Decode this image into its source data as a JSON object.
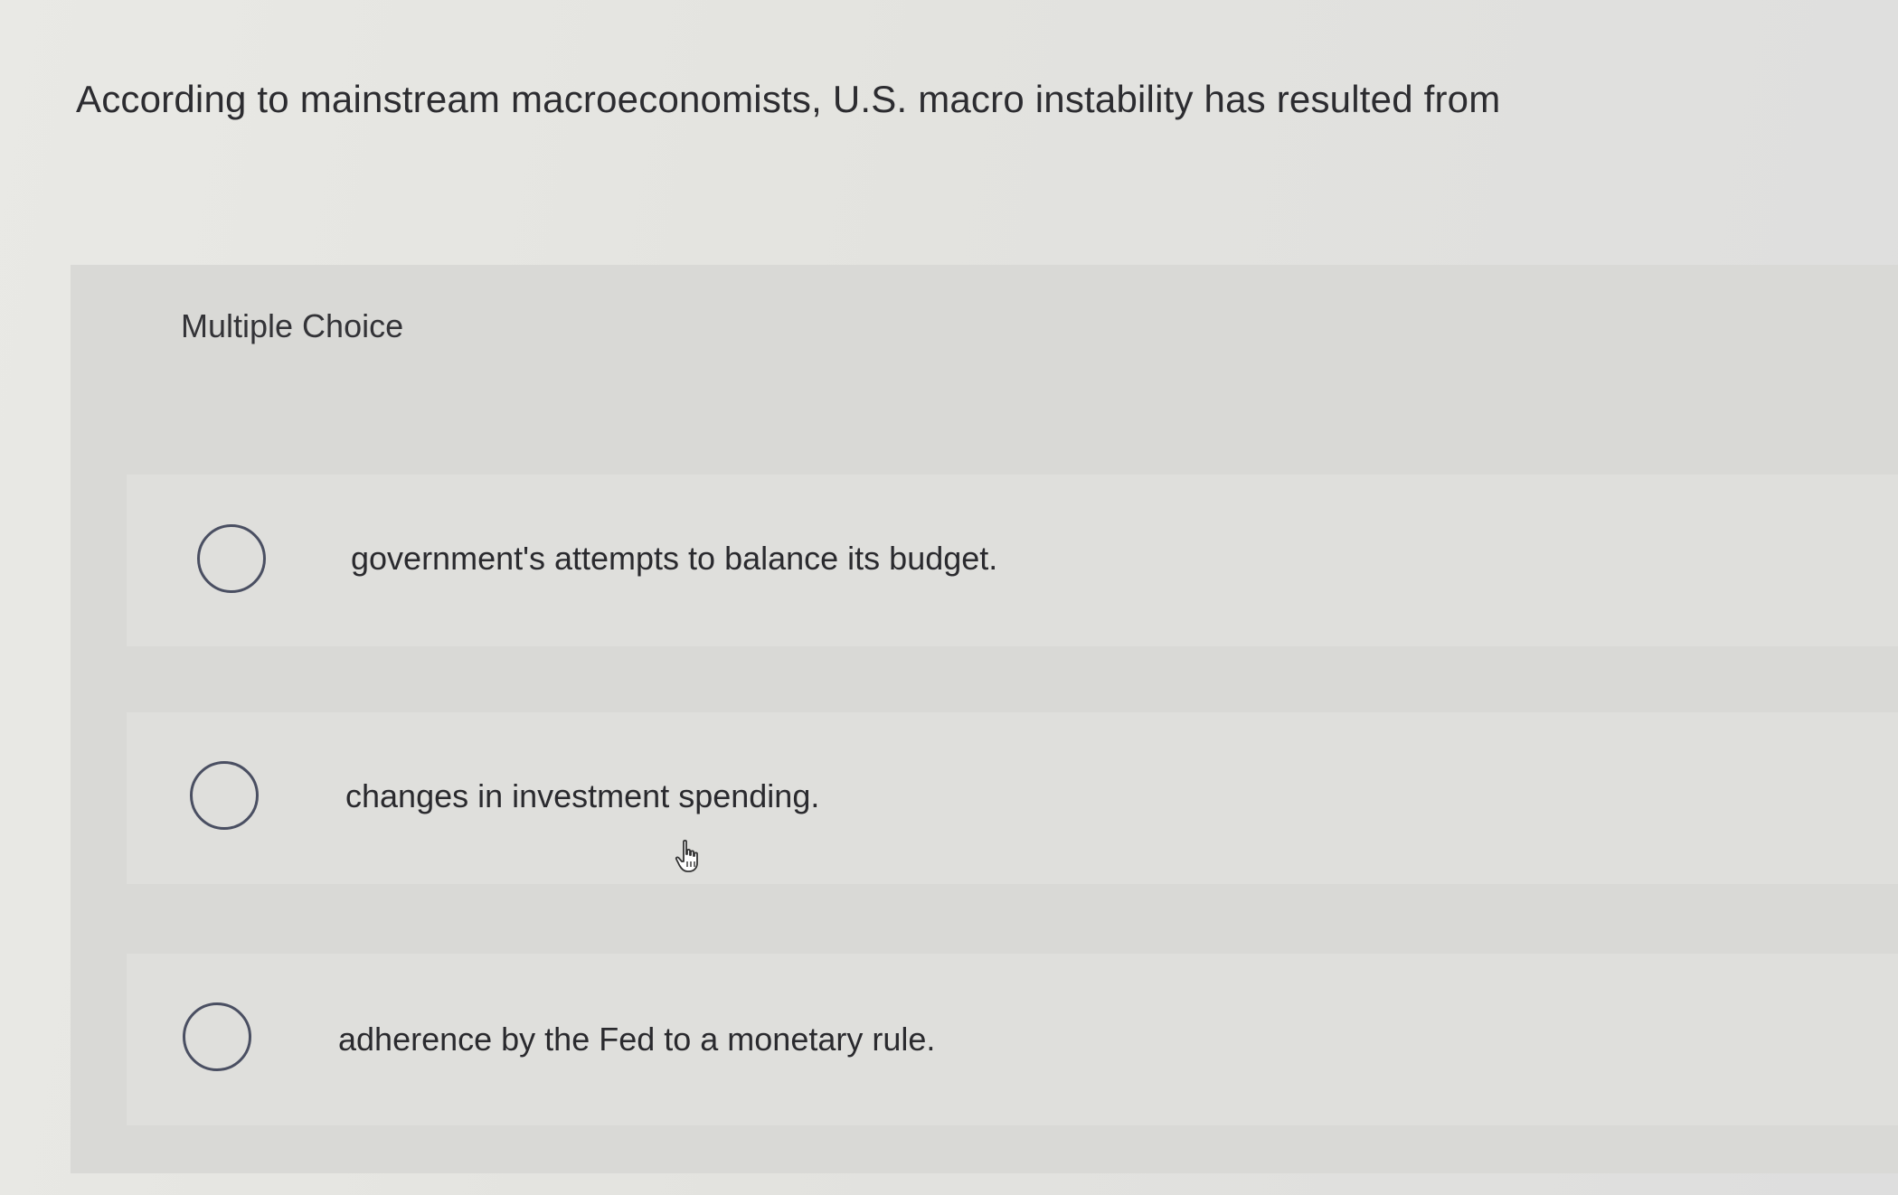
{
  "question": {
    "text": "According to mainstream macroeconomists, U.S. macro instability has resulted from"
  },
  "multiple_choice": {
    "label": "Multiple Choice",
    "options": [
      {
        "text": "government's attempts to balance its budget.",
        "selected": false
      },
      {
        "text": "changes in investment spending.",
        "selected": false
      },
      {
        "text": "adherence by the Fed to a monetary rule.",
        "selected": false
      }
    ]
  },
  "colors": {
    "background": "#e6e6e2",
    "panel": "#d9d9d6",
    "radio_border": "#4a4f62",
    "text": "#2a2a2e"
  },
  "icons": {
    "cursor": "hand-pointer-icon",
    "radio": "radio-unchecked-icon"
  }
}
